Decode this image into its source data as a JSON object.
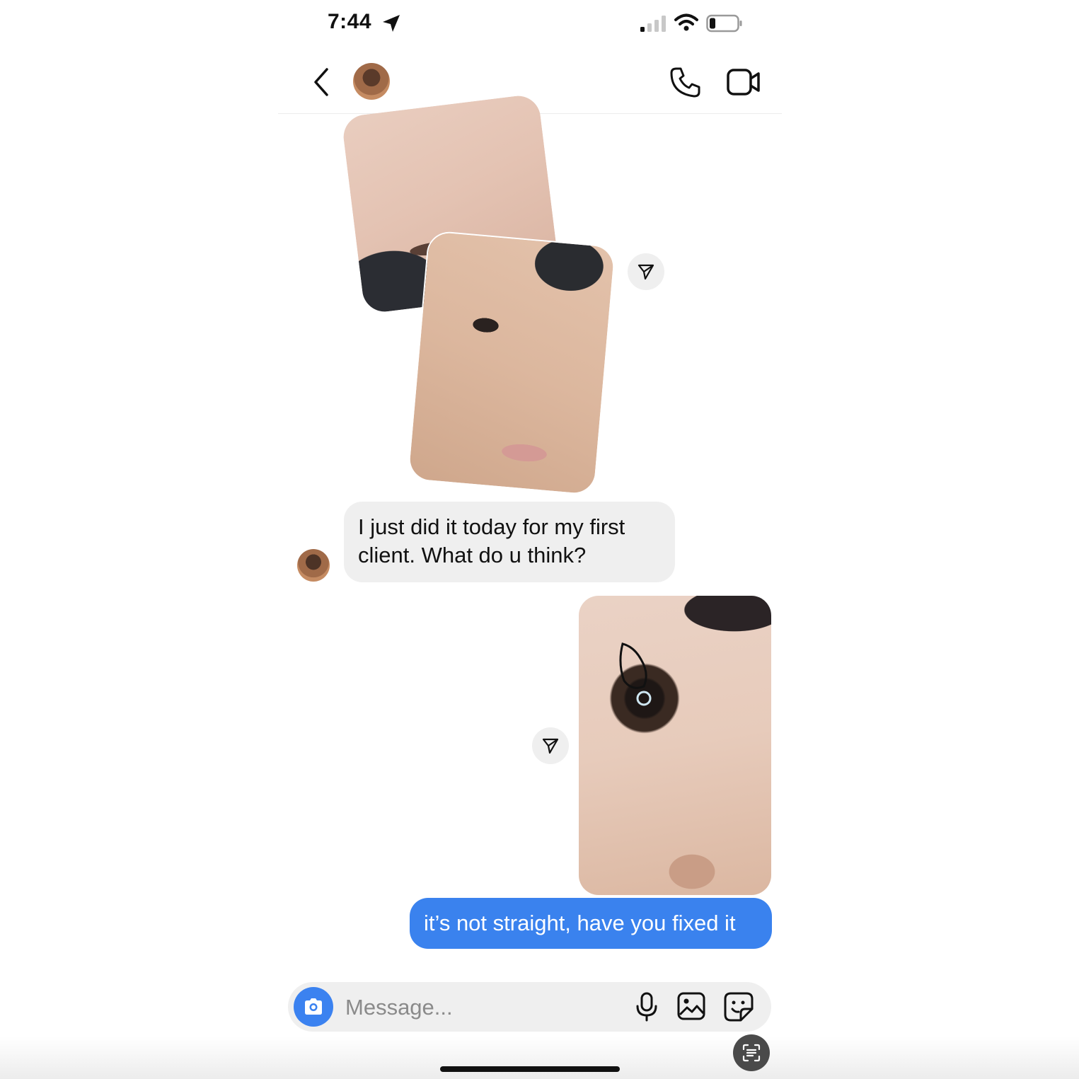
{
  "status_bar": {
    "time": "7:44",
    "icons": [
      "location-arrow-icon",
      "cellular-signal-icon",
      "wifi-icon",
      "battery-icon"
    ]
  },
  "header": {
    "icons": [
      "back-chevron-icon",
      "contact-avatar",
      "phone-call-icon",
      "video-call-icon"
    ]
  },
  "messages": [
    {
      "sender": "contact",
      "type": "photo-stack",
      "count": 2
    },
    {
      "sender": "contact",
      "type": "text",
      "text": "I just did it today for my first client. What do u think?"
    },
    {
      "sender": "me",
      "type": "photo",
      "annotated": true
    },
    {
      "sender": "me",
      "type": "text",
      "text": "it’s not straight, have you fixed it"
    }
  ],
  "composer": {
    "placeholder": "Message...",
    "icons": [
      "camera-icon",
      "microphone-icon",
      "gallery-icon",
      "sticker-icon"
    ]
  },
  "colors": {
    "outgoing_bubble": "#3a82ee",
    "incoming_bubble": "#efefef",
    "camera_button": "#3b82f0"
  }
}
